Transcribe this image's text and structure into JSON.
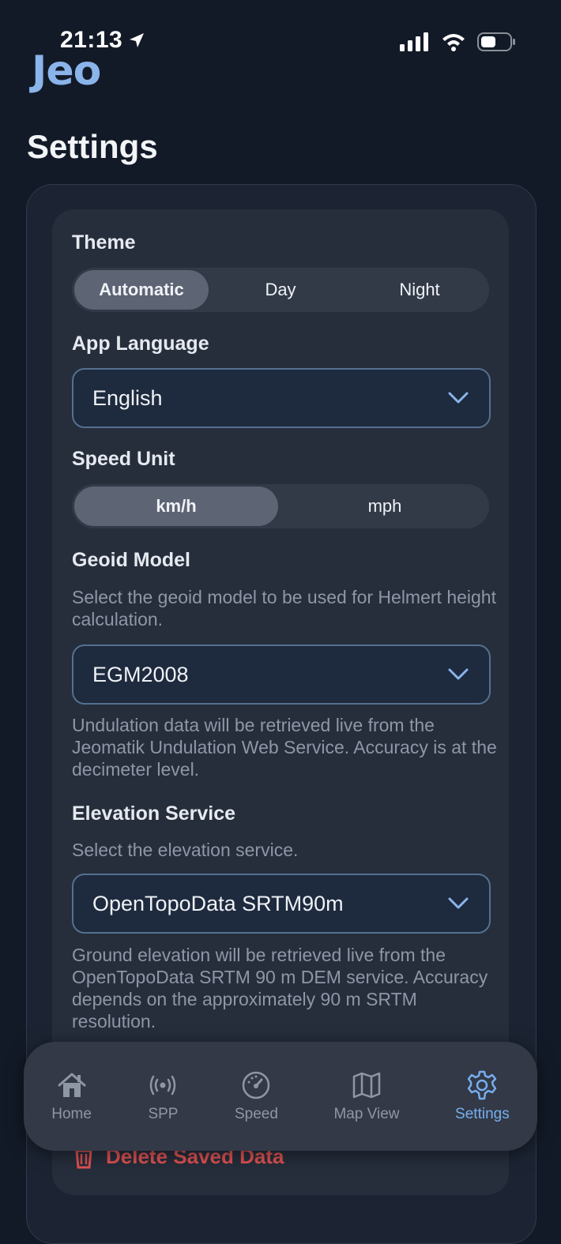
{
  "status_bar": {
    "time": "21:13"
  },
  "app": {
    "logo": "Jeo"
  },
  "page": {
    "title": "Settings"
  },
  "theme": {
    "label": "Theme",
    "options": [
      "Automatic",
      "Day",
      "Night"
    ],
    "selected": "Automatic"
  },
  "language": {
    "label": "App Language",
    "value": "English"
  },
  "speed_unit": {
    "label": "Speed Unit",
    "options": [
      "km/h",
      "mph"
    ],
    "selected": "km/h"
  },
  "geoid": {
    "label": "Geoid Model",
    "description": "Select the geoid model to be used for Helmert height calculation.",
    "value": "EGM2008",
    "note": "Undulation data will be retrieved live from the Jeomatik Undulation Web Service. Accuracy is at the decimeter level."
  },
  "elevation": {
    "label": "Elevation Service",
    "description": "Select the elevation service.",
    "value": "OpenTopoData SRTM90m",
    "note": "Ground elevation will be retrieved live from the OpenTopoData SRTM 90 m DEM service. Accuracy depends on the approximately 90 m SRTM resolution."
  },
  "delete": {
    "label": "Delete Saved Data"
  },
  "tabs": [
    {
      "label": "Home",
      "icon": "home-icon"
    },
    {
      "label": "SPP",
      "icon": "signal-icon"
    },
    {
      "label": "Speed",
      "icon": "speedometer-icon"
    },
    {
      "label": "Map View",
      "icon": "map-icon"
    },
    {
      "label": "Settings",
      "icon": "gear-icon"
    }
  ],
  "colors": {
    "accent": "#76aef0",
    "danger": "#e05252",
    "background": "#131a27"
  }
}
